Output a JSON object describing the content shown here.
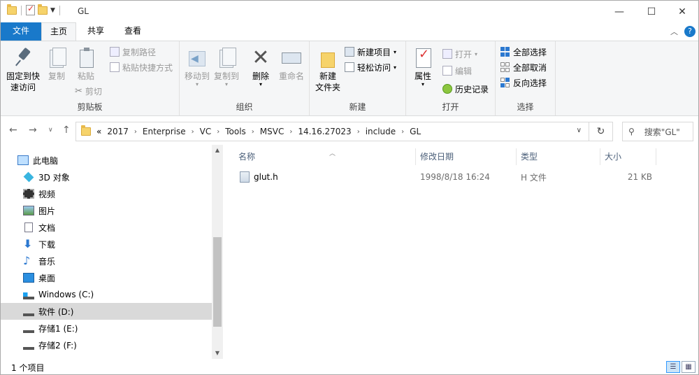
{
  "title": "GL",
  "window_controls": {
    "minimize": "—",
    "maximize": "☐",
    "close": "✕"
  },
  "tabs": {
    "file": "文件",
    "home": "主页",
    "share": "共享",
    "view": "查看"
  },
  "ribbon": {
    "clipboard": {
      "label": "剪贴板",
      "pin": "固定到快\n速访问",
      "pin_line1": "固定到快",
      "pin_line2": "速访问",
      "copy": "复制",
      "paste": "粘贴",
      "copy_path": "复制路径",
      "paste_shortcut": "粘贴快捷方式",
      "cut": "剪切"
    },
    "organize": {
      "label": "组织",
      "move_to": "移动到",
      "copy_to": "复制到",
      "delete": "删除",
      "rename": "重命名"
    },
    "new": {
      "label": "新建",
      "new_folder_line1": "新建",
      "new_folder_line2": "文件夹",
      "new_item": "新建项目",
      "easy_access": "轻松访问"
    },
    "open": {
      "label": "打开",
      "properties": "属性",
      "open": "打开",
      "edit": "编辑",
      "history": "历史记录"
    },
    "select": {
      "label": "选择",
      "select_all": "全部选择",
      "select_none": "全部取消",
      "invert": "反向选择"
    }
  },
  "address": {
    "overflow": "«",
    "crumbs": [
      "2017",
      "Enterprise",
      "VC",
      "Tools",
      "MSVC",
      "14.16.27023",
      "include",
      "GL"
    ]
  },
  "search": {
    "placeholder": "搜索\"GL\""
  },
  "nav": {
    "items": [
      {
        "label": "此电脑",
        "icon": "pc-icon"
      },
      {
        "label": "3D 对象",
        "icon": "cube-3d-icon"
      },
      {
        "label": "视频",
        "icon": "video-icon"
      },
      {
        "label": "图片",
        "icon": "picture-icon"
      },
      {
        "label": "文档",
        "icon": "document-icon"
      },
      {
        "label": "下载",
        "icon": "download-icon"
      },
      {
        "label": "音乐",
        "icon": "music-icon"
      },
      {
        "label": "桌面",
        "icon": "desktop-icon"
      },
      {
        "label": "Windows (C:)",
        "icon": "windows-drive-icon"
      },
      {
        "label": "软件 (D:)",
        "icon": "drive-icon"
      },
      {
        "label": "存储1 (E:)",
        "icon": "drive-icon"
      },
      {
        "label": "存储2 (F:)",
        "icon": "drive-icon"
      }
    ],
    "selected_index": 9
  },
  "columns": {
    "name": "名称",
    "modified": "修改日期",
    "type": "类型",
    "size": "大小"
  },
  "files": [
    {
      "name": "glut.h",
      "modified": "1998/8/18 16:24",
      "type": "H 文件",
      "size": "21 KB"
    }
  ],
  "status": {
    "count": "1 个项目"
  },
  "colors": {
    "accent": "#1979ca",
    "folder": "#f6d36b",
    "selected": "#d9d9d9"
  }
}
